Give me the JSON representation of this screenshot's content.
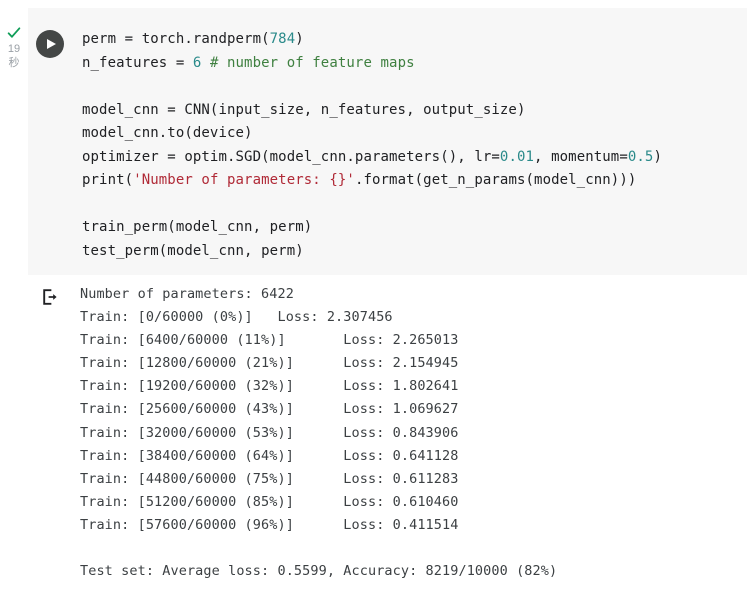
{
  "gutter": {
    "status_icon": "check-icon",
    "run_time_value": "19",
    "run_time_unit": "秒"
  },
  "code_cell": {
    "run_button_icon": "play-icon",
    "language": "python",
    "lines": [
      [
        {
          "t": "plain",
          "v": "perm = torch.randperm("
        },
        {
          "t": "num",
          "v": "784"
        },
        {
          "t": "plain",
          "v": ")"
        }
      ],
      [
        {
          "t": "plain",
          "v": "n_features = "
        },
        {
          "t": "num",
          "v": "6"
        },
        {
          "t": "plain",
          "v": " "
        },
        {
          "t": "com",
          "v": "# number of feature maps"
        }
      ],
      [],
      [
        {
          "t": "plain",
          "v": "model_cnn = CNN(input_size, n_features, output_size)"
        }
      ],
      [
        {
          "t": "plain",
          "v": "model_cnn.to(device)"
        }
      ],
      [
        {
          "t": "plain",
          "v": "optimizer = optim.SGD(model_cnn.parameters(), lr="
        },
        {
          "t": "num",
          "v": "0.01"
        },
        {
          "t": "plain",
          "v": ", momentum="
        },
        {
          "t": "num",
          "v": "0.5"
        },
        {
          "t": "plain",
          "v": ")"
        }
      ],
      [
        {
          "t": "plain",
          "v": "print("
        },
        {
          "t": "str",
          "v": "'Number of parameters: {}'"
        },
        {
          "t": "plain",
          "v": ".format(get_n_params(model_cnn)))"
        }
      ],
      [],
      [
        {
          "t": "plain",
          "v": "train_perm(model_cnn, perm)"
        }
      ],
      [
        {
          "t": "plain",
          "v": "test_perm(model_cnn, perm)"
        }
      ]
    ]
  },
  "output_cell": {
    "icon": "output-arrow-icon",
    "lines": [
      "Number of parameters: 6422",
      "Train: [0/60000 (0%)]\tLoss: 2.307456",
      "Train: [6400/60000 (11%)]\tLoss: 2.265013",
      "Train: [12800/60000 (21%)]\tLoss: 2.154945",
      "Train: [19200/60000 (32%)]\tLoss: 1.802641",
      "Train: [25600/60000 (43%)]\tLoss: 1.069627",
      "Train: [32000/60000 (53%)]\tLoss: 0.843906",
      "Train: [38400/60000 (64%)]\tLoss: 0.641128",
      "Train: [44800/60000 (75%)]\tLoss: 0.611283",
      "Train: [51200/60000 (85%)]\tLoss: 0.610460",
      "Train: [57600/60000 (96%)]\tLoss: 0.411514",
      "",
      "Test set: Average loss: 0.5599, Accuracy: 8219/10000 (82%)"
    ]
  },
  "colors": {
    "cell_background": "#f7f7f7",
    "page_background": "#ffffff",
    "code_text": "#202124",
    "number_token": "#2a8a8a",
    "comment_token": "#3f8040",
    "string_token": "#b02a37",
    "output_text": "#3c4043",
    "success_check": "#0f9d58",
    "gutter_text": "#9aa0a6",
    "run_button_fill": "#444746"
  }
}
